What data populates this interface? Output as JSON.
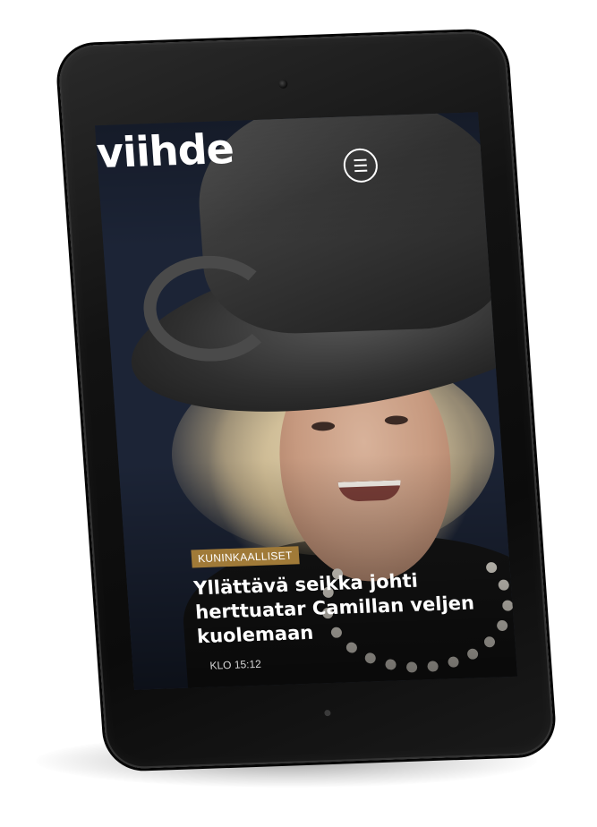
{
  "app": {
    "logo_text": "viihde"
  },
  "header": {
    "menu_icon": "hamburger-menu-icon"
  },
  "article": {
    "category": "KUNINKAALLISET",
    "headline": "Yllättävä seikka johti herttuatar Camillan veljen kuolemaan",
    "time": "KLO 15:12",
    "category_color": "#a07a38"
  },
  "device": {
    "camera_icon": "front-camera-icon",
    "home_indicator_icon": "home-indicator-icon"
  }
}
